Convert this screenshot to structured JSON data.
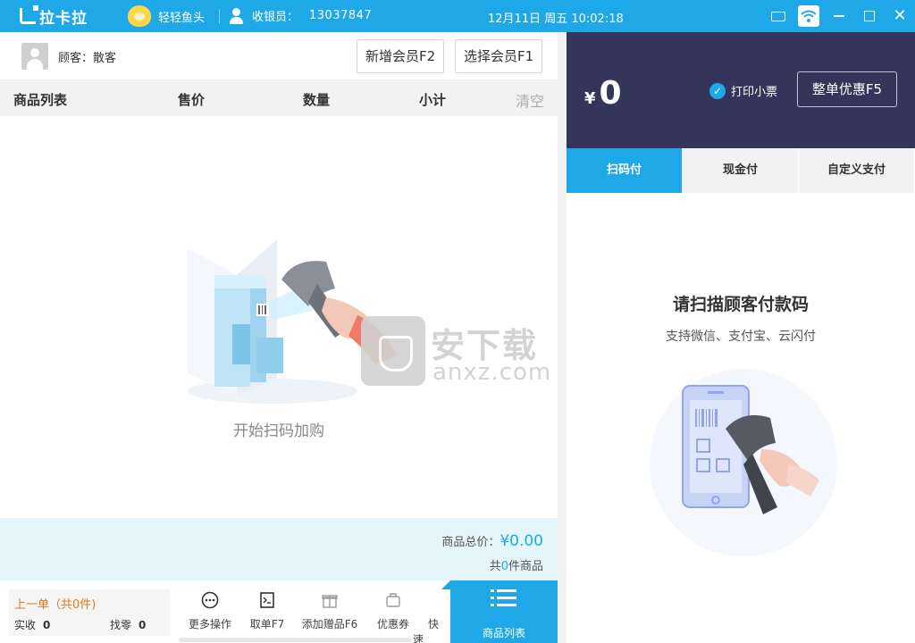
{
  "titlebar": {
    "app_name": "拉卡拉",
    "store_name": "轻轻鱼头",
    "cashier_label": "收银员：",
    "cashier_id": "13037847",
    "datetime": "12月11日 周五 10:02:18",
    "accent_color": "#1fa8e8"
  },
  "member": {
    "customer_label": "顾客：散客",
    "add_member_label": "新增会员F2",
    "select_member_label": "选择会员F1"
  },
  "table_header": {
    "col_goods": "商品列表",
    "col_price": "售价",
    "col_qty": "数量",
    "col_subtotal": "小计",
    "clear_label": "清空"
  },
  "empty_state": {
    "text": "开始扫码加购"
  },
  "watermark": {
    "cn": "安下载",
    "en": "anxz.com"
  },
  "totals": {
    "total_label": "商品总价：",
    "total_value": "¥0.00",
    "count_prefix": "共",
    "count_value": "0",
    "count_suffix": "件商品"
  },
  "last_order": {
    "title": "上一单（共0件)",
    "paid_label": "实收",
    "paid_value": "0",
    "change_label": "找零",
    "change_value": "0"
  },
  "actions": [
    {
      "label": "更多操作",
      "icon": "more-icon"
    },
    {
      "label": "取单F7",
      "icon": "retrieve-order-icon"
    },
    {
      "label": "添加赠品F6",
      "icon": "gift-icon"
    },
    {
      "label": "优惠券",
      "icon": "coupon-icon"
    },
    {
      "label": "快速",
      "icon": "quick-icon"
    }
  ],
  "goods_list_btn": {
    "label": "商品列表"
  },
  "payment": {
    "currency": "¥",
    "amount": "0",
    "print_receipt_label": "打印小票",
    "print_receipt_checked": true,
    "whole_discount_label": "整单优惠F5",
    "panel_color": "#34355a",
    "tabs": [
      "扫码付",
      "现金付",
      "自定义支付"
    ],
    "active_tab": 0,
    "scan_title": "请扫描顾客付款码",
    "scan_subtitle": "支持微信、支付宝、云闪付"
  }
}
